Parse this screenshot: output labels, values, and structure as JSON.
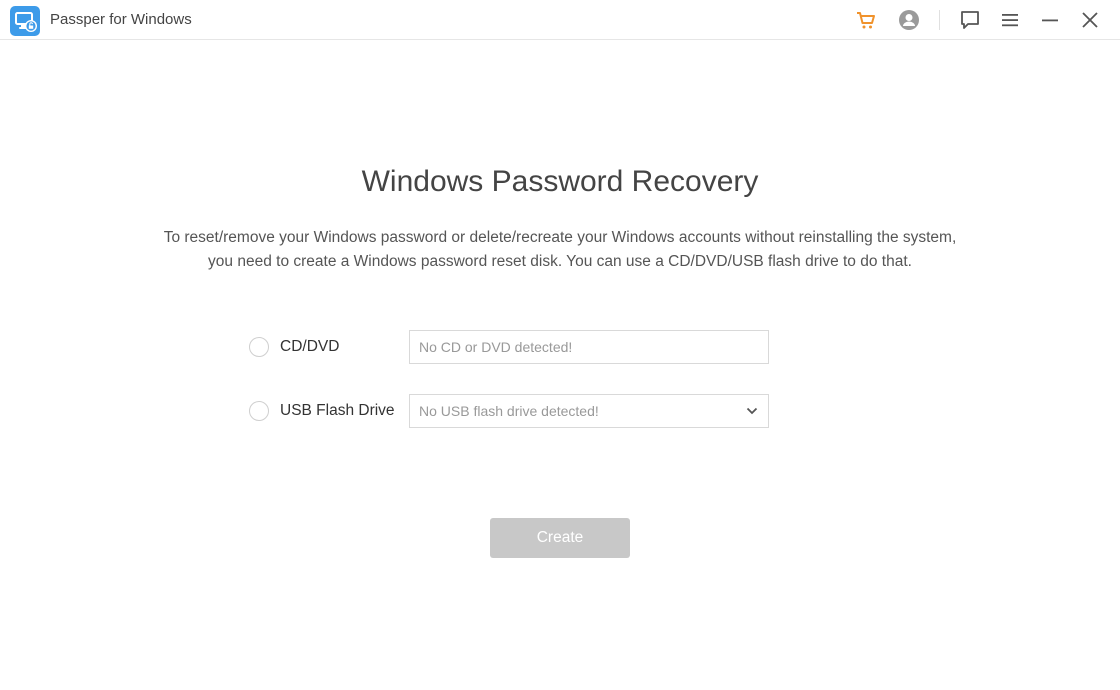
{
  "app": {
    "title": "Passper for Windows",
    "logo_icon": "monitor-lock-icon"
  },
  "titlebar": {
    "icons": {
      "cart": "cart-icon",
      "account": "account-icon",
      "feedback": "feedback-icon",
      "menu": "menu-icon",
      "minimize": "minimize-icon",
      "close": "close-icon"
    },
    "colors": {
      "cart": "#f0922b",
      "account": "#9a9a9a",
      "default": "#555555"
    }
  },
  "main": {
    "title": "Windows Password Recovery",
    "description_line1": "To reset/remove your Windows password or delete/recreate your Windows accounts without reinstalling the system,",
    "description_line2": "you need to create a Windows password reset disk. You can use a CD/DVD/USB flash drive to do that.",
    "options": [
      {
        "label": "CD/DVD",
        "selected": false,
        "field_placeholder": "No CD or DVD detected!",
        "field_type": "text"
      },
      {
        "label": "USB Flash Drive",
        "selected": false,
        "field_placeholder": "No USB flash drive detected!",
        "field_type": "dropdown"
      }
    ],
    "create_button": "Create",
    "create_enabled": false
  },
  "colors": {
    "brand": "#3d9be9",
    "button_disabled": "#c8c8c8"
  }
}
